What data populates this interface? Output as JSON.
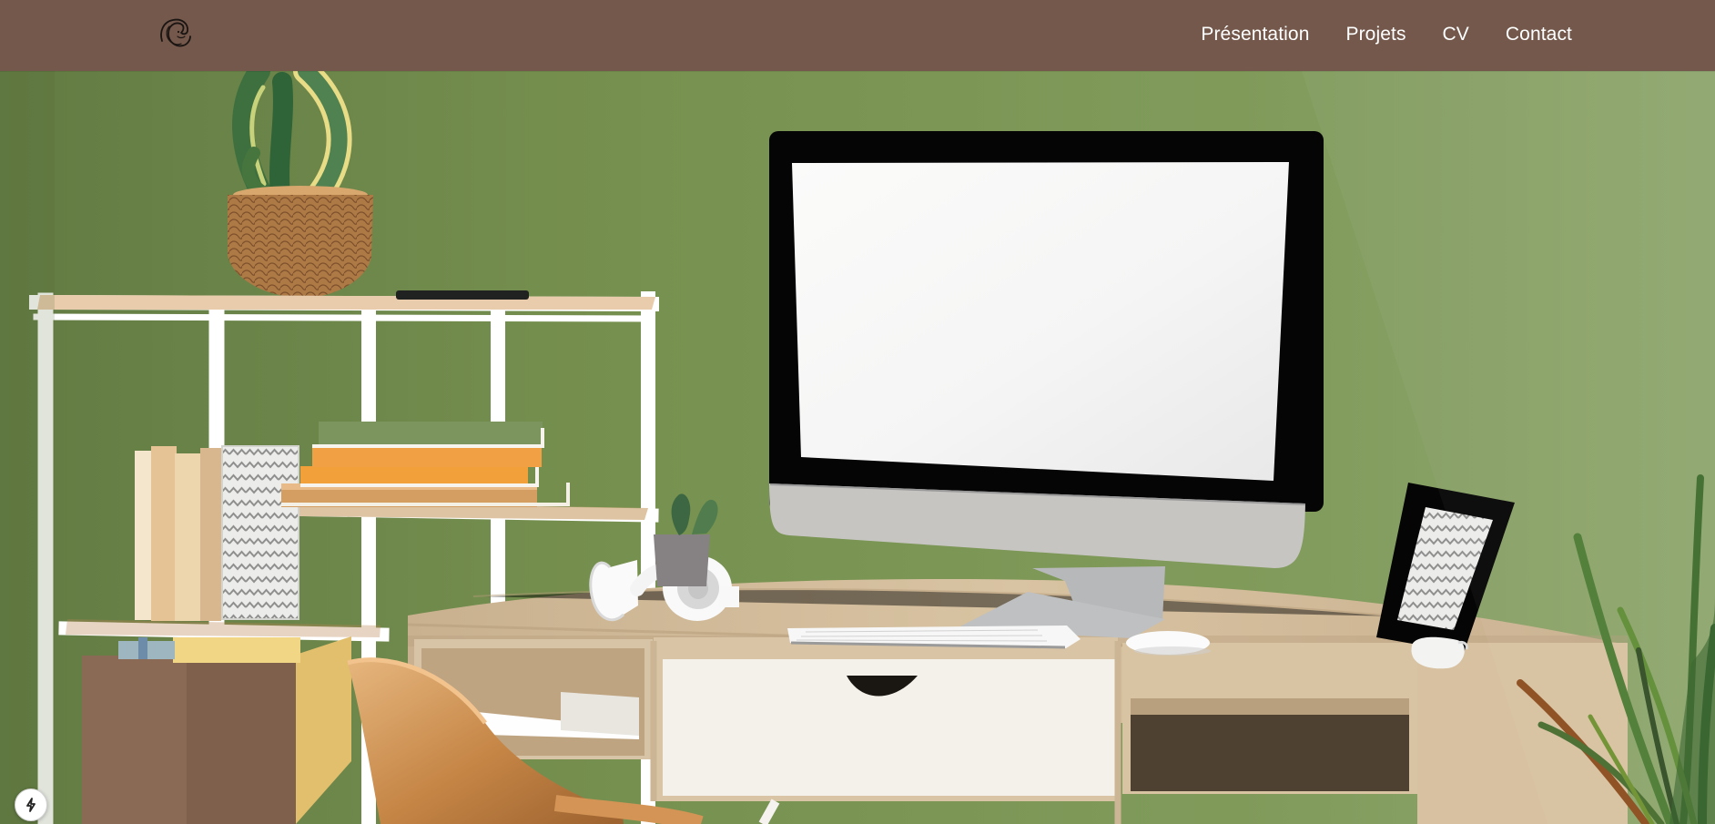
{
  "navbar": {
    "logo_icon": "scribble-face-logo-icon",
    "links": [
      {
        "label": "Présentation"
      },
      {
        "label": "Projets"
      },
      {
        "label": "CV"
      },
      {
        "label": "Contact"
      }
    ]
  },
  "hero": {
    "image": "home-office-desk-photo"
  },
  "fab": {
    "icon": "lightning-bolt-icon"
  },
  "colors": {
    "navbar_background": "#73584b",
    "nav_text": "#ffffff",
    "wall_green": "#7a9157"
  }
}
